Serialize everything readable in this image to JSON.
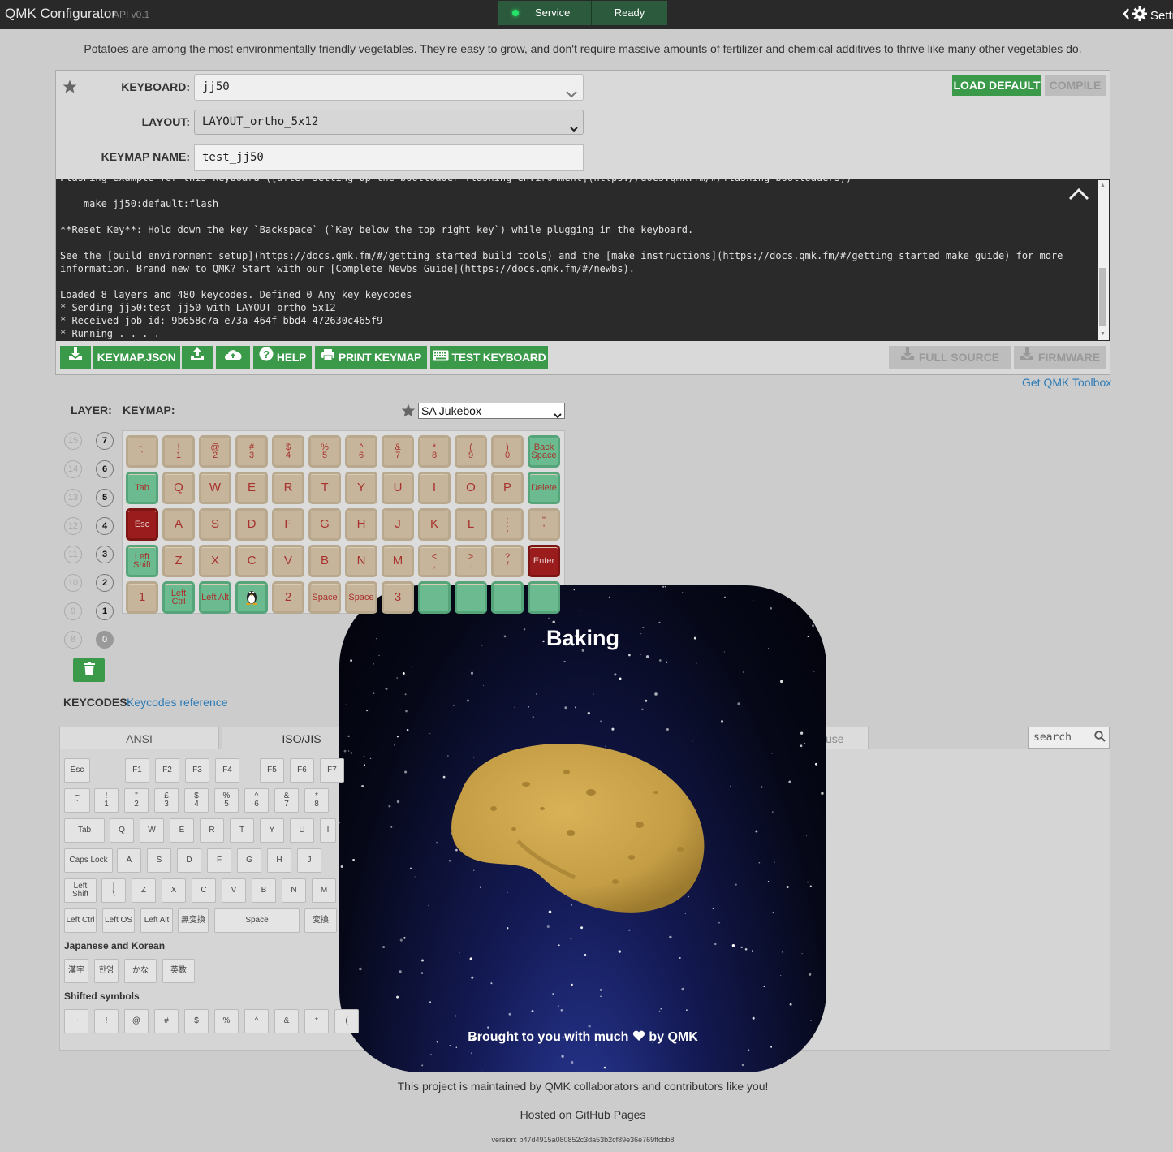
{
  "app": {
    "name": "QMK Configurator",
    "api_version": "API v0.1"
  },
  "status": {
    "service": "Service",
    "state": "Ready",
    "settings": "Setti"
  },
  "tagline": "Potatoes are among the most environmentally friendly vegetables. They're easy to grow, and don't require massive amounts of fertilizer and chemical additives to thrive like many other vegetables do.",
  "form": {
    "keyboard_label": "KEYBOARD:",
    "keyboard_value": "jj50",
    "layout_label": "LAYOUT:",
    "layout_value": "LAYOUT_ortho_5x12",
    "keymap_name_label": "KEYMAP NAME:",
    "keymap_name_value": "test_jj50",
    "load_default": "LOAD DEFAULT",
    "compile": "COMPILE"
  },
  "console_text": "Flashing example for this keyboard ([after setting up the bootloader flashing environment](https://docs.qmk.fm/#/flashing_bootloaders))\n\n    make jj50:default:flash\n\n**Reset Key**: Hold down the key `Backspace` (`Key below the top right key`) while plugging in the keyboard.\n\nSee the [build environment setup](https://docs.qmk.fm/#/getting_started_build_tools) and the [make instructions](https://docs.qmk.fm/#/getting_started_make_guide) for more\ninformation. Brand new to QMK? Start with our [Complete Newbs Guide](https://docs.qmk.fm/#/newbs).\n\nLoaded 8 layers and 480 keycodes. Defined 0 Any key keycodes\n* Sending jj50:test_jj50 with LAYOUT_ortho_5x12\n* Received job_id: 9b658c7a-e73a-464f-bbd4-472630c465f9\n* Running . . . .",
  "toolbar": {
    "keymap_json": "KEYMAP.JSON",
    "help": "HELP",
    "print_keymap": "PRINT KEYMAP",
    "test_keyboard": "TEST KEYBOARD",
    "full_source": "FULL SOURCE",
    "firmware": "FIRMWARE",
    "get_toolbox": "Get QMK Toolbox"
  },
  "keymap_section": {
    "layer_label": "LAYER:",
    "keymap_label": "KEYMAP:",
    "colorway": "SA Jukebox",
    "layers_left": [
      "15",
      "14",
      "13",
      "12",
      "11",
      "10",
      "9",
      "8"
    ],
    "layers_right": [
      "7",
      "6",
      "5",
      "4",
      "3",
      "2",
      "1",
      "0"
    ]
  },
  "keymap_rows": [
    [
      [
        "~",
        "`"
      ],
      [
        "!",
        "1"
      ],
      [
        "@",
        "2"
      ],
      [
        "#",
        "3"
      ],
      [
        "$",
        "4"
      ],
      [
        "%",
        "5"
      ],
      [
        "^",
        "6"
      ],
      [
        "&",
        "7"
      ],
      [
        "*",
        "8"
      ],
      [
        "(",
        "9"
      ],
      [
        ")",
        "0"
      ],
      [
        "Back",
        "Space"
      ]
    ],
    [
      "Tab",
      "Q",
      "W",
      "E",
      "R",
      "T",
      "Y",
      "U",
      "I",
      "O",
      "P",
      "Delete"
    ],
    [
      "Esc",
      "A",
      "S",
      "D",
      "F",
      "G",
      "H",
      "J",
      "K",
      "L",
      [
        ":",
        ";"
      ],
      [
        "\"",
        "'"
      ]
    ],
    [
      [
        "Left",
        "Shift"
      ],
      "Z",
      "X",
      "C",
      "V",
      "B",
      "N",
      "M",
      [
        "<",
        ","
      ],
      [
        ">",
        "."
      ],
      [
        "?",
        "/"
      ],
      "Enter"
    ],
    [
      "1",
      [
        "Left",
        "Ctrl"
      ],
      "Left Alt",
      "linux",
      "2",
      "Space",
      "Space",
      "3",
      "",
      "",
      "",
      ""
    ]
  ],
  "keycodes": {
    "label": "KEYCODES:",
    "reference": "Keycodes reference",
    "tabs": [
      "ANSI",
      "ISO/JIS",
      "use"
    ],
    "search_placeholder": "search",
    "japanese_korean": "Japanese and Korean",
    "shifted_symbols": "Shifted symbols",
    "row_fn": [
      "Esc",
      "F1",
      "F2",
      "F3",
      "F4",
      "F5",
      "F6",
      "F7"
    ],
    "row_num": [
      [
        "~",
        "`"
      ],
      [
        "!",
        "1"
      ],
      [
        "\"",
        "2"
      ],
      [
        "£",
        "3"
      ],
      [
        "$",
        "4"
      ],
      [
        "%",
        "5"
      ],
      [
        "^",
        "6"
      ],
      [
        "&",
        "7"
      ],
      [
        "*",
        "8"
      ]
    ],
    "row_q": [
      "Tab",
      "Q",
      "W",
      "E",
      "R",
      "T",
      "Y",
      "U",
      "I"
    ],
    "row_a": [
      "Caps Lock",
      "A",
      "S",
      "D",
      "F",
      "G",
      "H",
      "J"
    ],
    "row_z": [
      [
        "Left",
        "Shift"
      ],
      [
        "|",
        "\\"
      ],
      "Z",
      "X",
      "C",
      "V",
      "B",
      "N",
      "M"
    ],
    "row_mod": [
      "Left Ctrl",
      "Left OS",
      "Left Alt",
      "無変換",
      "Space",
      "変換"
    ],
    "jk_keys": [
      "漢字",
      "한영",
      "かな",
      "英数"
    ],
    "shifted_keys": [
      "~",
      "!",
      "@",
      "#",
      "$",
      "%",
      "^",
      "&",
      "*",
      "("
    ]
  },
  "modal": {
    "title": "Baking",
    "footer_pre": "Brought to you with much",
    "footer_post": "by QMK"
  },
  "footer": {
    "line1": "This project is maintained by QMK collaborators and contributors like you!",
    "line2": "Hosted on GitHub Pages",
    "version": "version: b47d4915a080852c3da53b2cf89e36e769ffcbb8"
  },
  "colors": {
    "green": "#3a9a4a",
    "key_beige": "#c6b59b",
    "key_green": "#6cba8f",
    "key_red": "#9b1c1c",
    "legend_red": "#a8322e"
  }
}
